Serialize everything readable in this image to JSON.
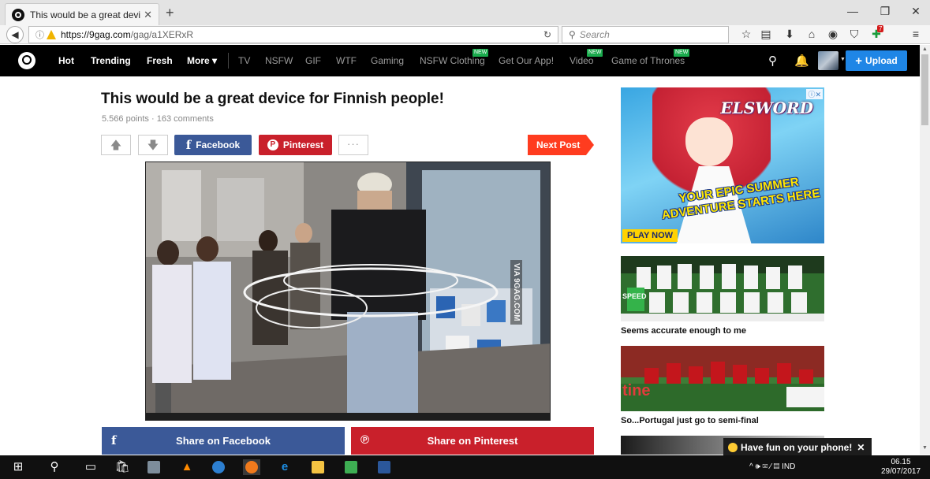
{
  "browser": {
    "tab_title": "This would be a great devi...",
    "tab_close": "✕",
    "new_tab": "+",
    "url_host": "https://9gag.com",
    "url_path": "/gag/a1XERxR",
    "search_placeholder": "Search",
    "window_controls": [
      "—",
      "❐",
      "✕"
    ],
    "toolbar_icons": [
      "star-icon",
      "reading-list-icon",
      "download-icon",
      "home-icon",
      "pocket-icon",
      "shield-icon",
      "addon-icon",
      "menu-icon"
    ],
    "addon_badge": "7"
  },
  "site": {
    "nav": [
      {
        "label": "Hot",
        "style": "bold"
      },
      {
        "label": "Trending",
        "style": "bold"
      },
      {
        "label": "Fresh",
        "style": "bold"
      },
      {
        "label": "More ▾",
        "style": "bold"
      },
      {
        "label": "TV",
        "style": "dim"
      },
      {
        "label": "NSFW",
        "style": "dim"
      },
      {
        "label": "GIF",
        "style": "dim"
      },
      {
        "label": "WTF",
        "style": "dim"
      },
      {
        "label": "Gaming",
        "style": "dim"
      },
      {
        "label": "NSFW Clothing",
        "style": "dim",
        "badge": "NEW"
      },
      {
        "label": "Get Our App!",
        "style": "dim"
      },
      {
        "label": "Video",
        "style": "dim",
        "badge": "NEW"
      },
      {
        "label": "Game of Thrones",
        "style": "dim",
        "badge": "NEW"
      }
    ],
    "upload_label": "Upload",
    "upload_icon": "+"
  },
  "post": {
    "title": "This would be a great device for Finnish people!",
    "meta": "5.566 points · 163 comments",
    "facebook_label": "Facebook",
    "pinterest_label": "Pinterest",
    "more_label": "···",
    "next_label": "Next Post",
    "watermark": "VIA 9GAG.COM",
    "share_facebook": "Share on Facebook",
    "share_pinterest": "Share on Pinterest"
  },
  "sidebar": {
    "ad": {
      "logo": "ELSWORD",
      "headline": "YOUR EPIC SUMMER ADVENTURE STARTS HERE",
      "cta": "PLAY NOW",
      "choices": "ⓘ✕"
    },
    "items": [
      {
        "caption": "Seems accurate enough to me"
      },
      {
        "caption": "So...Portugal just go to semi-final"
      }
    ],
    "thumb1_overlay": "SPEED",
    "thumb2_overlay": "tine",
    "colors": {
      "germany_shirt": "#f4f4f4",
      "portugal_shirt": "#c4161c"
    }
  },
  "toast": {
    "text": "Have fun on your phone!",
    "close": "✕"
  },
  "taskbar": {
    "tray": "^ 🕪 ✉ ⁄ ▤ IND",
    "time": "06.15",
    "date": "29/07/2017"
  },
  "colors": {
    "nextpost": "#ff3c1f",
    "facebook": "#3b5998",
    "pinterest": "#c9202b",
    "upload": "#1f86e6",
    "new_badge": "#1aab4d"
  }
}
